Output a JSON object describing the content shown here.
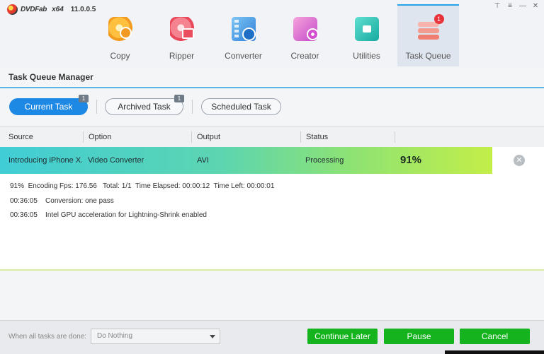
{
  "app": {
    "logo_text": "DVDFab",
    "arch": "x64",
    "version": "11.0.0.5"
  },
  "window_controls": [
    "⊤",
    "≡",
    "—",
    "✕"
  ],
  "nav": {
    "items": [
      {
        "label": "Copy",
        "icon": "copy-disc-icon"
      },
      {
        "label": "Ripper",
        "icon": "ripper-disc-icon"
      },
      {
        "label": "Converter",
        "icon": "converter-film-icon"
      },
      {
        "label": "Creator",
        "icon": "creator-icon"
      },
      {
        "label": "Utilities",
        "icon": "utilities-toolbox-icon"
      },
      {
        "label": "Task Queue",
        "icon": "task-queue-icon",
        "badge": "1",
        "active": true
      }
    ]
  },
  "manager": {
    "title": "Task Queue Manager"
  },
  "tabs": [
    {
      "label": "Current Task",
      "badge": "1",
      "active": true
    },
    {
      "label": "Archived Task",
      "badge": "1"
    },
    {
      "label": "Scheduled Task"
    }
  ],
  "table": {
    "columns": [
      "Source",
      "Option",
      "Output",
      "Status"
    ],
    "row": {
      "source": "Introducing iPhone X...",
      "option": "Video Converter",
      "output": "AVI",
      "status": "Processing",
      "percent_text": "91%",
      "progress": 0.91
    }
  },
  "log": [
    "91%  Encoding Fps: 176.56   Total: 1/1  Time Elapsed: 00:00:12  Time Left: 00:00:01",
    "00:36:05    Conversion: one pass",
    "00:36:05    Intel GPU acceleration for Lightning-Shrink enabled"
  ],
  "footer": {
    "label": "When all tasks are done:",
    "select_value": "Do Nothing",
    "continue_label": "Continue Later",
    "pause_label": "Pause",
    "cancel_label": "Cancel"
  },
  "colors": {
    "accent_blue": "#1e88e5",
    "button_green": "#15b41e",
    "badge_red": "#e8333b"
  }
}
